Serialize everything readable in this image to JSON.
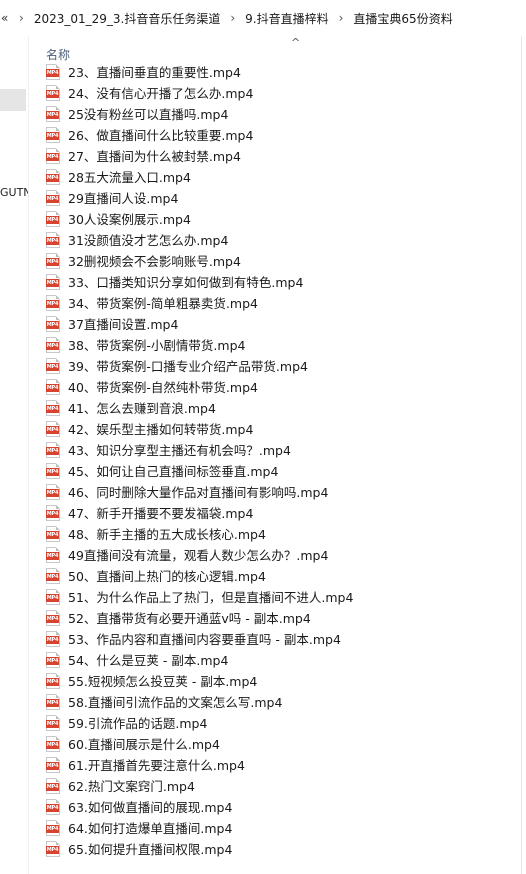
{
  "breadcrumb": {
    "overflow": "«",
    "items": [
      "2023_01_29_3.抖音音乐任务渠道",
      "9.抖音直播梓料",
      "直播宝典65份资料"
    ],
    "separator": "›"
  },
  "nav": {
    "partial_text": "GUTN"
  },
  "columns": {
    "name_label": "名称",
    "sort_indicator": "^"
  },
  "file_icon": {
    "name": "video-file-icon",
    "badge": "MP4",
    "badge_color": "#d8432f"
  },
  "files": [
    "23、直播间垂直的重要性.mp4",
    "24、没有信心开播了怎么办.mp4",
    "25没有粉丝可以直播吗.mp4",
    "26、做直播间什么比较重要.mp4",
    "27、直播间为什么被封禁.mp4",
    "28五大流量入口.mp4",
    "29直播间人设.mp4",
    "30人设案例展示.mp4",
    "31没颜值没才艺怎么办.mp4",
    "32删视频会不会影响账号.mp4",
    "33、口播类知识分享如何做到有特色.mp4",
    "34、带货案例-简单粗暴卖货.mp4",
    "37直播间设置.mp4",
    "38、带货案例-小剧情带货.mp4",
    "39、带货案例-口播专业介绍产品带货.mp4",
    "40、带货案例-自然纯朴带货.mp4",
    "41、怎么去赚到音浪.mp4",
    "42、娱乐型主播如何转带货.mp4",
    "43、知识分享型主播还有机会吗？.mp4",
    "45、如何让自己直播间标签垂直.mp4",
    "46、同时删除大量作品对直播间有影响吗.mp4",
    "47、新手开播要不要发福袋.mp4",
    "48、新手主播的五大成长核心.mp4",
    "49直播间没有流量，观看人数少怎么办？.mp4",
    "50、直播间上热门的核心逻辑.mp4",
    "51、为什么作品上了热门，但是直播间不进人.mp4",
    "52、直播带货有必要开通蓝v吗 - 副本.mp4",
    "53、作品内容和直播间内容要垂直吗 - 副本.mp4",
    "54、什么是豆荚 - 副本.mp4",
    "55.短视频怎么投豆荚 - 副本.mp4",
    "58.直播间引流作品的文案怎么写.mp4",
    "59.引流作品的话题.mp4",
    "60.直播间展示是什么.mp4",
    "61.开直播首先要注意什么.mp4",
    "62.热门文案窍门.mp4",
    "63.如何做直播间的展现.mp4",
    "64.如何打造爆单直播间.mp4",
    "65.如何提升直播间权限.mp4"
  ]
}
